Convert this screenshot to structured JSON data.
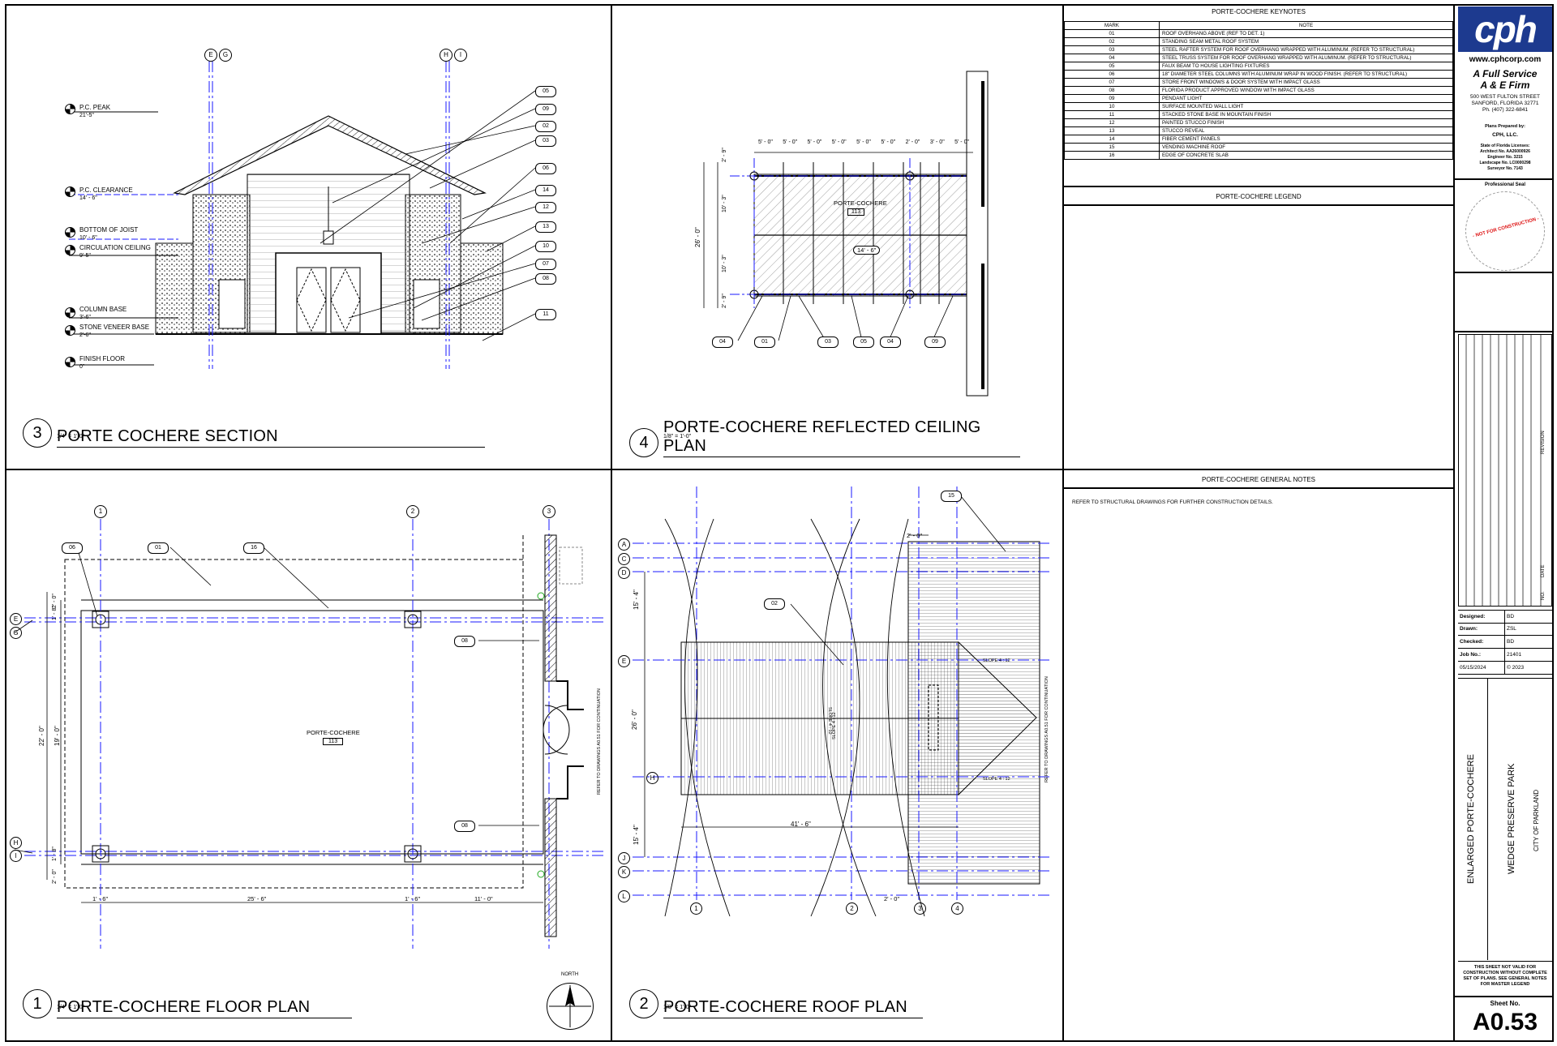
{
  "views": {
    "section": {
      "number": "3",
      "title": "PORTE COCHERE SECTION",
      "scale": "1/4\" = 1'-0\""
    },
    "rcp": {
      "number": "4",
      "title": "PORTE-COCHERE REFLECTED CEILING PLAN",
      "scale": "1/8\" = 1'-0\""
    },
    "floor": {
      "number": "1",
      "title": "PORTE-COCHERE FLOOR PLAN",
      "scale": "1/4\" = 1'-0\""
    },
    "roof": {
      "number": "2",
      "title": "PORTE-COCHERE ROOF PLAN",
      "scale": "1/8\" = 1'-0\""
    }
  },
  "section_levels": [
    {
      "name": "P.C. PEAK",
      "elev": "21'-5\""
    },
    {
      "name": "P.C. CLEARANCE",
      "elev": "14' - 6\""
    },
    {
      "name": "BOTTOM OF JOIST",
      "elev": "10' - 6\""
    },
    {
      "name": "CIRCULATION CEILING",
      "elev": "9'-5\""
    },
    {
      "name": "COLUMN BASE",
      "elev": "3'-6\""
    },
    {
      "name": "STONE VENEER BASE",
      "elev": "2'-6\""
    },
    {
      "name": "FINISH FLOOR",
      "elev": "0\""
    }
  ],
  "section_grids": [
    "E",
    "G",
    "H",
    "I"
  ],
  "section_tags": [
    "05",
    "09",
    "02",
    "03",
    "06",
    "14",
    "12",
    "13",
    "10",
    "07",
    "08",
    "11"
  ],
  "rcp": {
    "room_name": "PORTE-COCHERE",
    "room_number": "113",
    "height": "14' - 6\"",
    "top_dims": [
      "5' - 0\"",
      "5' - 0\"",
      "5' - 0\"",
      "5' - 0\"",
      "5' - 0\"",
      "5' - 0\"",
      "2' - 0\"",
      "3' - 0\"",
      "5' - 0\""
    ],
    "left_dims": [
      "2' - 9\"",
      "10' - 3\"",
      "10' - 3\"",
      "2' - 9\""
    ],
    "overall": "26' - 0\"",
    "tags": [
      "04",
      "01",
      "03",
      "05",
      "04",
      "09"
    ]
  },
  "floor": {
    "room_name": "PORTE-COCHERE",
    "room_number": "113",
    "grids_top": [
      "1",
      "2",
      "3"
    ],
    "grids_left": [
      "E",
      "G",
      "H",
      "I"
    ],
    "tags": [
      "06",
      "01",
      "16",
      "08",
      "08"
    ],
    "dims_left": [
      "2' - 0\"",
      "1' - 8\"",
      "22' - 0\"",
      "19' - 0\"",
      "1' - 8\"",
      "2' - 0\""
    ],
    "dims_bottom": [
      "1' - 6\"",
      "25' - 6\"",
      "1' - 6\"",
      "11' - 0\""
    ],
    "side_note": "REFER TO DRAWINGS A0.51 FOR CONTINUATION",
    "north": "NORTH"
  },
  "roof": {
    "grids_left": [
      "A",
      "C",
      "D",
      "E",
      "H",
      "J",
      "K",
      "L"
    ],
    "grids_bottom": [
      "1",
      "2",
      "3",
      "4"
    ],
    "tags": [
      "15",
      "02"
    ],
    "dims": [
      "2' - 0\"",
      "15' - 4\"",
      "26' - 0\"",
      "15' - 4\"",
      "41' - 6\"",
      "2' - 0\""
    ],
    "slopes": [
      "SLOPE 4 : 12",
      "SLOPE 4 : 12",
      "SLOPE 4 : 12",
      "SLOPE 4 : 12"
    ],
    "side_note": "REFER TO DRAWINGS A0.51 FOR CONTINUATION"
  },
  "keynotes": {
    "title": "PORTE-COCHERE KEYNOTES",
    "headers": [
      "MARK",
      "NOTE"
    ],
    "rows": [
      [
        "01",
        "ROOF OVERHANG ABOVE (REF TO DET. 1)"
      ],
      [
        "02",
        "STANDING SEAM METAL ROOF SYSTEM"
      ],
      [
        "03",
        "STEEL RAFTER SYSTEM FOR ROOF OVERHANG WRAPPED WITH ALUMINUM. (REFER TO STRUCTURAL)"
      ],
      [
        "04",
        "STEEL TRUSS SYSTEM FOR ROOF OVERHANG WRAPPED WITH ALUMINUM. (REFER TO STRUCTURAL)"
      ],
      [
        "05",
        "FAUX BEAM TO HOUSE LIGHTING FIXTURES"
      ],
      [
        "06",
        "18\" DIAMETER STEEL COLUMNS WITH ALUMINUM WRAP IN WOOD FINISH. (REFER TO STRUCTURAL)"
      ],
      [
        "07",
        "STORE FRONT WINDOWS & DOOR SYSTEM WITH IMPACT GLASS"
      ],
      [
        "08",
        "FLORIDA PRODUCT APPROVED WINDOW WITH IMPACT GLASS"
      ],
      [
        "09",
        "PENDANT LIGHT"
      ],
      [
        "10",
        "SURFACE MOUNTED WALL LIGHT"
      ],
      [
        "11",
        "STACKED STONE BASE IN MOUNTAIN FINISH"
      ],
      [
        "12",
        "PAINTED STUCCO FINISH"
      ],
      [
        "13",
        "STUCCO REVEAL"
      ],
      [
        "14",
        "FIBER CEMENT PANELS"
      ],
      [
        "15",
        "VENDING MACHINE ROOF"
      ],
      [
        "16",
        "EDGE OF CONCRETE SLAB"
      ]
    ]
  },
  "legend_title": "PORTE-COCHERE LEGEND",
  "general_notes": {
    "title": "PORTE-COCHERE GENERAL NOTES",
    "text": "REFER TO STRUCTURAL DRAWINGS FOR FURTHER CONSTRUCTION DETAILS."
  },
  "titleblock": {
    "logo": "cph",
    "website": "www.cphcorp.com",
    "tagline1": "A Full Service",
    "tagline2": "A & E Firm",
    "address1": "500 WEST FULTON STREET",
    "address2": "SANFORD, FLORIDA 32771",
    "phone": "Ph. (407) 322-6841",
    "prepared_by_label": "Plans Prepared by:",
    "prepared_by": "CPH, LLC.",
    "licenses_label": "State of Florida Licenses:",
    "licenses": [
      "Architect No. AA26000926",
      "Engineer No. 3215",
      "Landscape No. LC0000298",
      "Surveyor No. 7143"
    ],
    "seal_label": "Professional Seal",
    "seal_stamp": "- NOT FOR CONSTRUCTION -",
    "revision_label": "REVISION",
    "no_label": "NO.",
    "date_label": "DATE",
    "info": [
      {
        "label": "Designed:",
        "value": "BD"
      },
      {
        "label": "Drawn:",
        "value": "ZSL"
      },
      {
        "label": "Checked:",
        "value": "BD"
      },
      {
        "label": "Job No.:",
        "value": "21401"
      },
      {
        "label": "05/15/2024",
        "value": "© 2023"
      }
    ],
    "sheet_title": "ENLARGED PORTE-COCHERE",
    "project": "WEDGE PRESERVE PARK",
    "client": "CITY OF PARKLAND",
    "validity": "THIS SHEET NOT VALID FOR CONSTRUCTION WITHOUT COMPLETE SET OF PLANS. SEE GENERAL NOTES FOR MASTER LEGEND",
    "sheet_no_label": "Sheet No.",
    "sheet_no": "A0.53"
  },
  "colors": {
    "grid_blue": "#1a1aff",
    "brand_blue": "#1d3a8f",
    "stamp_red": "#d11"
  }
}
